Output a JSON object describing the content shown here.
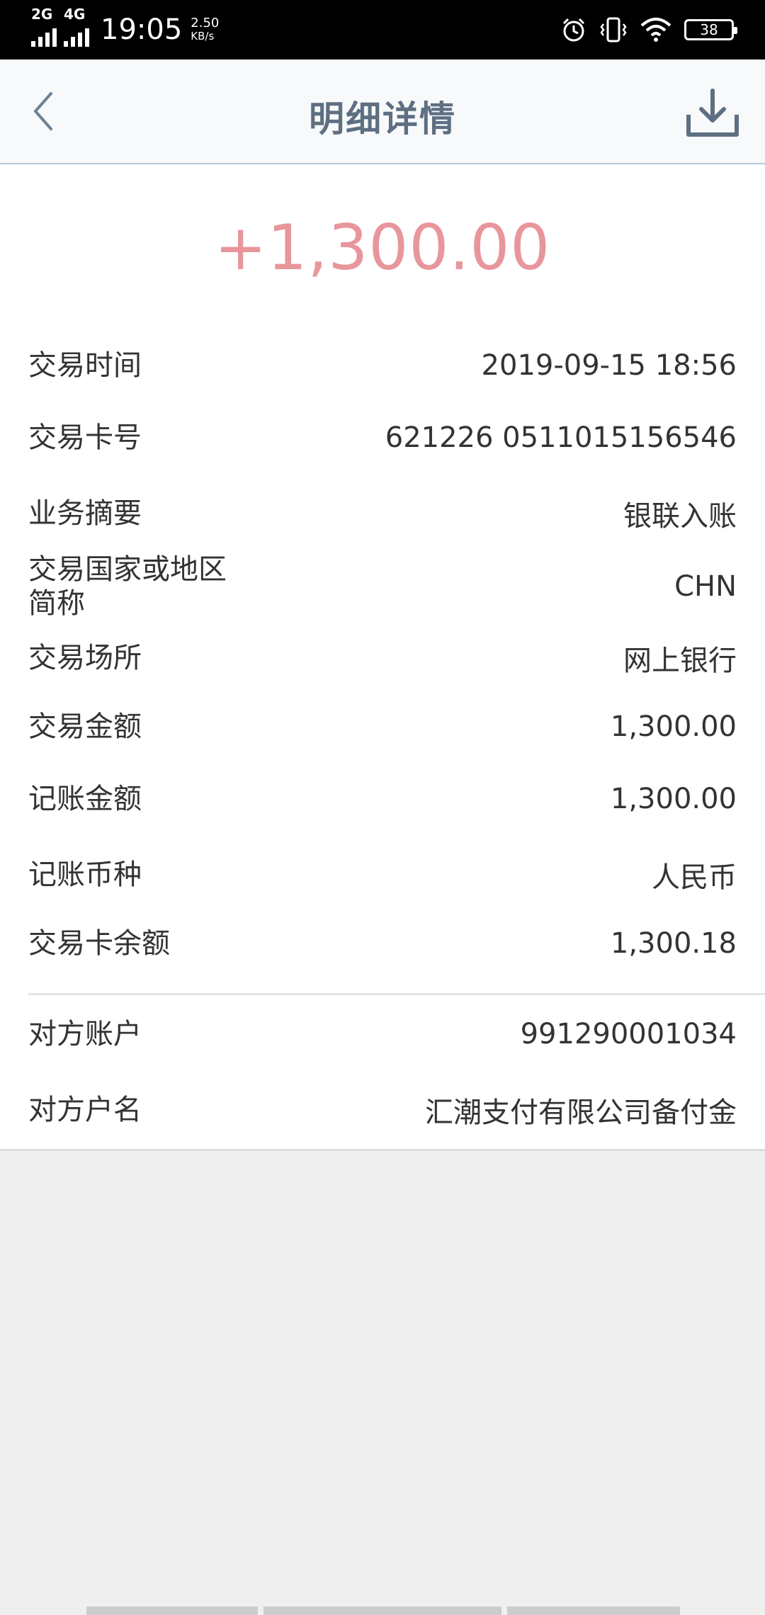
{
  "status_bar": {
    "net1": "2G",
    "net2": "4G",
    "time": "19:05",
    "speed_value": "2.50",
    "speed_unit": "KB/s",
    "battery": "38"
  },
  "header": {
    "title": "明细详情"
  },
  "amount": "+1,300.00",
  "rows": [
    {
      "label": "交易时间",
      "value": "2019-09-15 18:56"
    },
    {
      "label": "交易卡号",
      "value": "621226 0511015156546"
    },
    {
      "label": "业务摘要",
      "value": "银联入账"
    },
    {
      "label": "交易国家或地区\n简称",
      "label_line1": "交易国家或地区",
      "label_line2": "简称",
      "value": "CHN"
    },
    {
      "label": "交易场所",
      "value": "网上银行"
    },
    {
      "label": "交易金额",
      "value": "1,300.00"
    },
    {
      "label": "记账金额",
      "value": "1,300.00"
    },
    {
      "label": "记账币种",
      "value": "人民币"
    },
    {
      "label": "交易卡余额",
      "value": "1,300.18"
    },
    {
      "label": "对方账户",
      "value": "991290001034"
    },
    {
      "label": "对方户名",
      "value": "汇潮支付有限公司备付金"
    }
  ],
  "colors": {
    "amount": "#e8969c",
    "title": "#5e6f81",
    "header_border": "#b9c8d8"
  }
}
